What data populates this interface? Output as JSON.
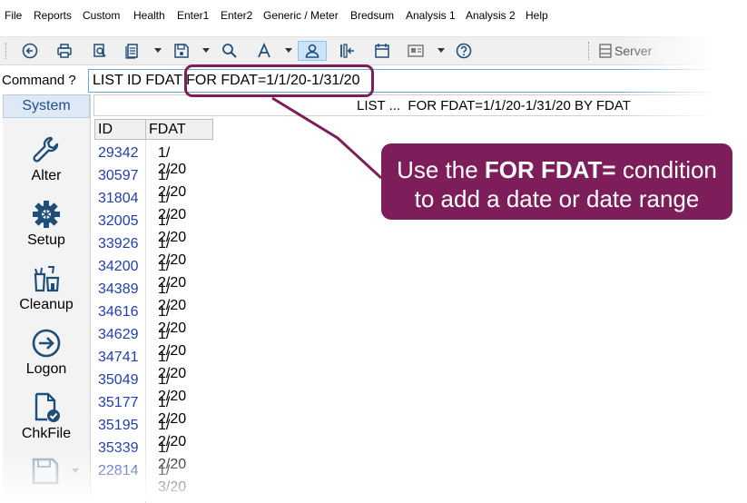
{
  "menu": [
    "File",
    "Reports",
    "Custom",
    "Health",
    "Enter1",
    "Enter2",
    "Generic / Meter",
    "Bredsum",
    "Analysis 1",
    "Analysis 2",
    "Help"
  ],
  "toolbar": {
    "icons": [
      "back-icon",
      "print-icon",
      "print-preview-icon",
      "report-icon",
      "save-icon",
      "search-icon",
      "font-icon",
      "user-icon",
      "import-icon",
      "calendar-icon",
      "screen-icon",
      "help-icon"
    ],
    "server_label": "Server"
  },
  "command": {
    "label": "Command ?",
    "value": "LIST ID FDAT FOR FDAT=1/1/20-1/31/20"
  },
  "sidebar": {
    "tab": "System",
    "items": [
      {
        "label": "Alter",
        "icon": "wrench-icon"
      },
      {
        "label": "Setup",
        "icon": "gear-icon"
      },
      {
        "label": "Cleanup",
        "icon": "cleanup-icon"
      },
      {
        "label": "Logon",
        "icon": "logon-icon"
      },
      {
        "label": "ChkFile",
        "icon": "check-file-icon"
      }
    ]
  },
  "results": {
    "header_text": "LIST ...  FOR FDAT=1/1/20-1/31/20 BY FDAT",
    "columns": [
      "ID",
      "FDAT"
    ],
    "rows": [
      [
        "29342",
        "1/ 2/20"
      ],
      [
        "30597",
        "1/ 2/20"
      ],
      [
        "31804",
        "1/ 2/20"
      ],
      [
        "32005",
        "1/ 2/20"
      ],
      [
        "33926",
        "1/ 2/20"
      ],
      [
        "34200",
        "1/ 2/20"
      ],
      [
        "34389",
        "1/ 2/20"
      ],
      [
        "34616",
        "1/ 2/20"
      ],
      [
        "34629",
        "1/ 2/20"
      ],
      [
        "34741",
        "1/ 2/20"
      ],
      [
        "35049",
        "1/ 2/20"
      ],
      [
        "35177",
        "1/ 2/20"
      ],
      [
        "35195",
        "1/ 2/20"
      ],
      [
        "35339",
        "1/ 2/20"
      ],
      [
        "22814",
        "1/ 3/20"
      ]
    ]
  },
  "callout": {
    "line1_pre": "Use the ",
    "line1_bold": "FOR FDAT=",
    "line1_post": " condition",
    "line2": "to add a date or date range"
  },
  "colors": {
    "accent": "#7d1e5a",
    "link": "#1f3fae",
    "icon": "#1f4e79"
  }
}
